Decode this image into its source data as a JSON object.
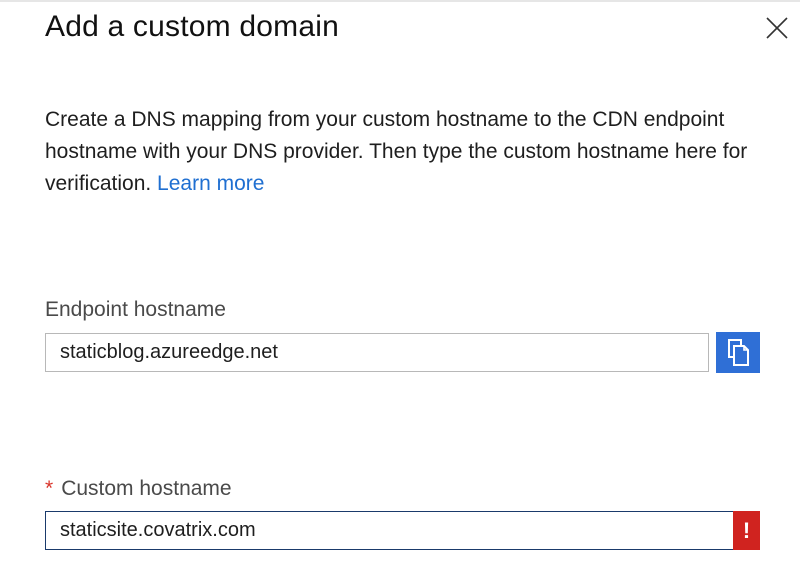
{
  "dialog": {
    "title": "Add a custom domain",
    "close_icon": "close-icon",
    "description": "Create a DNS mapping from your custom hostname to the CDN endpoint hostname with your DNS provider. Then type the custom hostname here for verification.",
    "learn_more": "Learn more"
  },
  "endpoint": {
    "label": "Endpoint hostname",
    "value": "staticblog.azureedge.net",
    "copy_icon": "copy-icon"
  },
  "custom": {
    "required_marker": "*",
    "label": "Custom hostname",
    "value": "staticsite.covatrix.com",
    "error_symbol": "!",
    "error_icon": "error-icon"
  },
  "colors": {
    "accent": "#2f6fd6",
    "link": "#1f6fd1",
    "error": "#d0231f",
    "required": "#d9352b"
  }
}
